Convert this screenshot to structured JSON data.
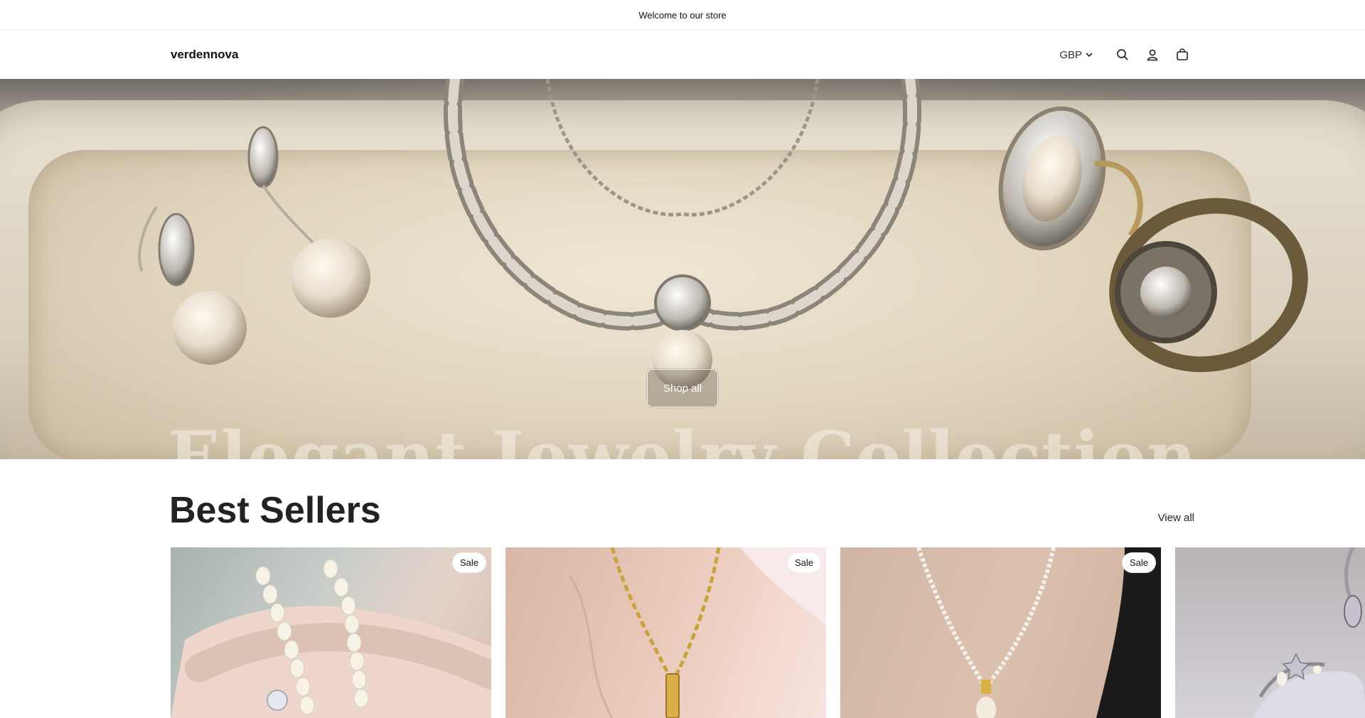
{
  "announcement": {
    "text": "Welcome to our store"
  },
  "header": {
    "logo": "verdennova",
    "currency": "GBP",
    "icons": [
      "search-icon",
      "account-icon",
      "cart-icon"
    ]
  },
  "hero": {
    "title": "Elegant Jewelry Collection",
    "button_label": "Shop all"
  },
  "best_sellers": {
    "title": "Best Sellers",
    "view_all": "View all",
    "products": [
      {
        "badge": "Sale",
        "image": "pearl-bracelet"
      },
      {
        "badge": "Sale",
        "image": "gold-pendant-necklace"
      },
      {
        "badge": "Sale",
        "image": "pearl-necklace"
      },
      {
        "badge": "",
        "image": "silver-charm"
      }
    ]
  },
  "colors": {
    "text": "#121212",
    "background": "#ffffff",
    "accent": "#222222"
  }
}
